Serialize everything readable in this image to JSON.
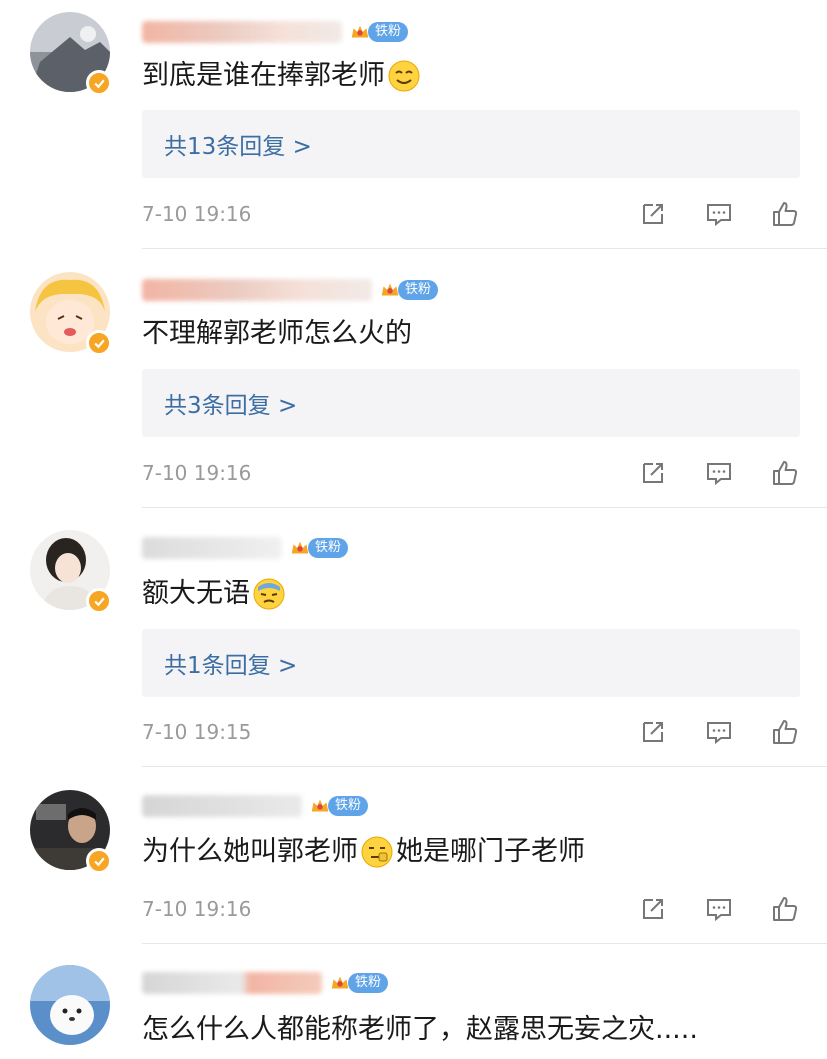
{
  "comments": [
    {
      "content": "到底是谁在捧郭老师",
      "fan_badge": "铁粉",
      "reply_label": "共13条回复 >",
      "time": "7-10 19:16"
    },
    {
      "content": "不理解郭老师怎么火的",
      "fan_badge": "铁粉",
      "reply_label": "共3条回复 >",
      "time": "7-10 19:16"
    },
    {
      "content": "额大无语",
      "fan_badge": "铁粉",
      "reply_label": "共1条回复 >",
      "time": "7-10 19:15"
    },
    {
      "content_part1": "为什么她叫郭老师",
      "content_part2": "她是哪门子老师",
      "fan_badge": "铁粉",
      "time": "7-10 19:16"
    },
    {
      "content": "怎么什么人都能称老师了，赵露思无妄之灾.....",
      "fan_badge": "铁粉"
    }
  ],
  "icons": {
    "share": "share-icon",
    "comment": "comment-icon",
    "like": "like-icon",
    "verified": "verified-badge-icon",
    "crown": "crown-icon"
  },
  "colors": {
    "reply_link": "#3c6ea3",
    "reply_bg": "#f4f4f6",
    "fan_badge": "#5fa4e8",
    "verified": "#f6a623",
    "timestamp": "#9a9a9a"
  }
}
